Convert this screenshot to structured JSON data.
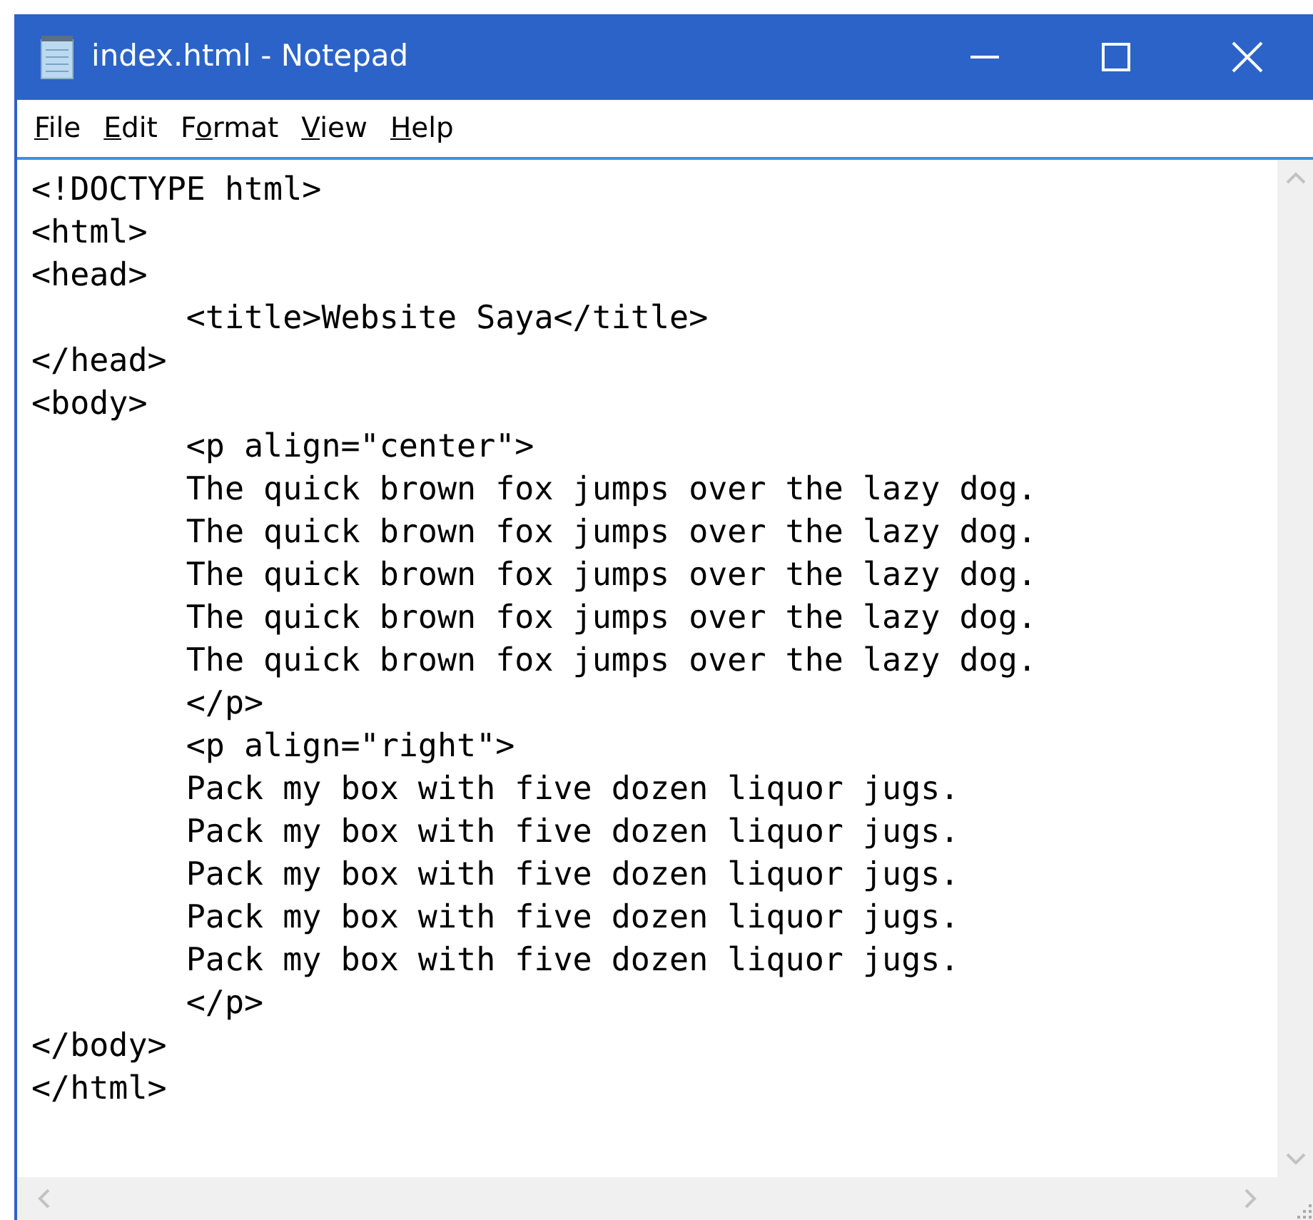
{
  "window": {
    "title": "index.html - Notepad"
  },
  "menu": [
    {
      "key": "F",
      "after": "ile"
    },
    {
      "key": "E",
      "after": "dit"
    },
    {
      "before": "F",
      "key": "o",
      "after": "rmat"
    },
    {
      "key": "V",
      "after": "iew"
    },
    {
      "key": "H",
      "after": "elp"
    }
  ],
  "editor": {
    "lines": [
      "<!DOCTYPE html>",
      "<html>",
      "<head>",
      "\t<title>Website Saya</title>",
      "</head>",
      "<body>",
      "\t<p align=\"center\">",
      "\tThe quick brown fox jumps over the lazy dog.",
      "\tThe quick brown fox jumps over the lazy dog.",
      "\tThe quick brown fox jumps over the lazy dog.",
      "\tThe quick brown fox jumps over the lazy dog.",
      "\tThe quick brown fox jumps over the lazy dog.",
      "\t</p>",
      "\t<p align=\"right\">",
      "\tPack my box with five dozen liquor jugs.",
      "\tPack my box with five dozen liquor jugs.",
      "\tPack my box with five dozen liquor jugs.",
      "\tPack my box with five dozen liquor jugs.",
      "\tPack my box with five dozen liquor jugs.",
      "\t</p>",
      "</body>",
      "</html>"
    ]
  }
}
